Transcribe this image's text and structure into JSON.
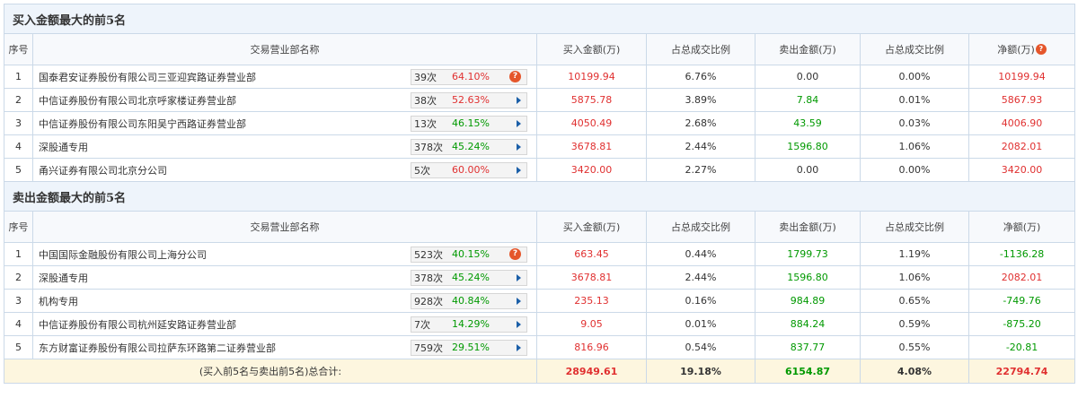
{
  "buy_section": {
    "title": "买入金额最大的前5名",
    "headers": [
      "序号",
      "交易营业部名称",
      "买入金额(万)",
      "占总成交比例",
      "卖出金额(万)",
      "占总成交比例",
      "净额(万)"
    ],
    "rows": [
      {
        "no": "1",
        "name": "国泰君安证券股份有限公司三亚迎宾路证券营业部",
        "times": "39次",
        "rate": "64.10%",
        "rate_color": "red",
        "icon": "question-icon",
        "buy": "10199.94",
        "buy_pct": "6.76%",
        "sell": "0.00",
        "sell_color": "dark",
        "sell_pct": "0.00%",
        "net": "10199.94",
        "net_color": "red"
      },
      {
        "no": "2",
        "name": "中信证券股份有限公司北京呼家楼证券营业部",
        "times": "38次",
        "rate": "52.63%",
        "rate_color": "red",
        "icon": "play-icon",
        "buy": "5875.78",
        "buy_pct": "3.89%",
        "sell": "7.84",
        "sell_color": "green",
        "sell_pct": "0.01%",
        "net": "5867.93",
        "net_color": "red"
      },
      {
        "no": "3",
        "name": "中信证券股份有限公司东阳吴宁西路证券营业部",
        "times": "13次",
        "rate": "46.15%",
        "rate_color": "green",
        "icon": "play-icon",
        "buy": "4050.49",
        "buy_pct": "2.68%",
        "sell": "43.59",
        "sell_color": "green",
        "sell_pct": "0.03%",
        "net": "4006.90",
        "net_color": "red"
      },
      {
        "no": "4",
        "name": "深股通专用",
        "times": "378次",
        "rate": "45.24%",
        "rate_color": "green",
        "icon": "play-icon",
        "buy": "3678.81",
        "buy_pct": "2.44%",
        "sell": "1596.80",
        "sell_color": "green",
        "sell_pct": "1.06%",
        "net": "2082.01",
        "net_color": "red"
      },
      {
        "no": "5",
        "name": "甬兴证券有限公司北京分公司",
        "times": "5次",
        "rate": "60.00%",
        "rate_color": "red",
        "icon": "play-icon",
        "buy": "3420.00",
        "buy_pct": "2.27%",
        "sell": "0.00",
        "sell_color": "dark",
        "sell_pct": "0.00%",
        "net": "3420.00",
        "net_color": "red"
      }
    ]
  },
  "sell_section": {
    "title": "卖出金额最大的前5名",
    "headers": [
      "序号",
      "交易营业部名称",
      "买入金额(万)",
      "占总成交比例",
      "卖出金额(万)",
      "占总成交比例",
      "净额(万)"
    ],
    "rows": [
      {
        "no": "1",
        "name": "中国国际金融股份有限公司上海分公司",
        "times": "523次",
        "rate": "40.15%",
        "rate_color": "green",
        "icon": "question-icon",
        "buy": "663.45",
        "buy_pct": "0.44%",
        "sell": "1799.73",
        "sell_color": "green",
        "sell_pct": "1.19%",
        "net": "-1136.28",
        "net_color": "green"
      },
      {
        "no": "2",
        "name": "深股通专用",
        "times": "378次",
        "rate": "45.24%",
        "rate_color": "green",
        "icon": "play-icon",
        "buy": "3678.81",
        "buy_pct": "2.44%",
        "sell": "1596.80",
        "sell_color": "green",
        "sell_pct": "1.06%",
        "net": "2082.01",
        "net_color": "red"
      },
      {
        "no": "3",
        "name": "机构专用",
        "times": "928次",
        "rate": "40.84%",
        "rate_color": "green",
        "icon": "play-icon",
        "buy": "235.13",
        "buy_pct": "0.16%",
        "sell": "984.89",
        "sell_color": "green",
        "sell_pct": "0.65%",
        "net": "-749.76",
        "net_color": "green"
      },
      {
        "no": "4",
        "name": "中信证券股份有限公司杭州延安路证券营业部",
        "times": "7次",
        "rate": "14.29%",
        "rate_color": "green",
        "icon": "play-icon",
        "buy": "9.05",
        "buy_pct": "0.01%",
        "sell": "884.24",
        "sell_color": "green",
        "sell_pct": "0.59%",
        "net": "-875.20",
        "net_color": "green"
      },
      {
        "no": "5",
        "name": "东方财富证券股份有限公司拉萨东环路第二证券营业部",
        "times": "759次",
        "rate": "29.51%",
        "rate_color": "green",
        "icon": "play-icon",
        "buy": "816.96",
        "buy_pct": "0.54%",
        "sell": "837.77",
        "sell_color": "green",
        "sell_pct": "0.55%",
        "net": "-20.81",
        "net_color": "green"
      }
    ]
  },
  "total": {
    "label": "(买入前5名与卖出前5名)总合计:",
    "buy": "28949.61",
    "buy_pct": "19.18%",
    "sell": "6154.87",
    "sell_pct": "4.08%",
    "net": "22794.74"
  },
  "colors": {
    "red": "#e03030",
    "green": "#009900",
    "border": "#cbd9e8",
    "section_bg": "#eef4fb",
    "total_bg": "#fdf6df",
    "link_blue": "#1b5fa8"
  }
}
